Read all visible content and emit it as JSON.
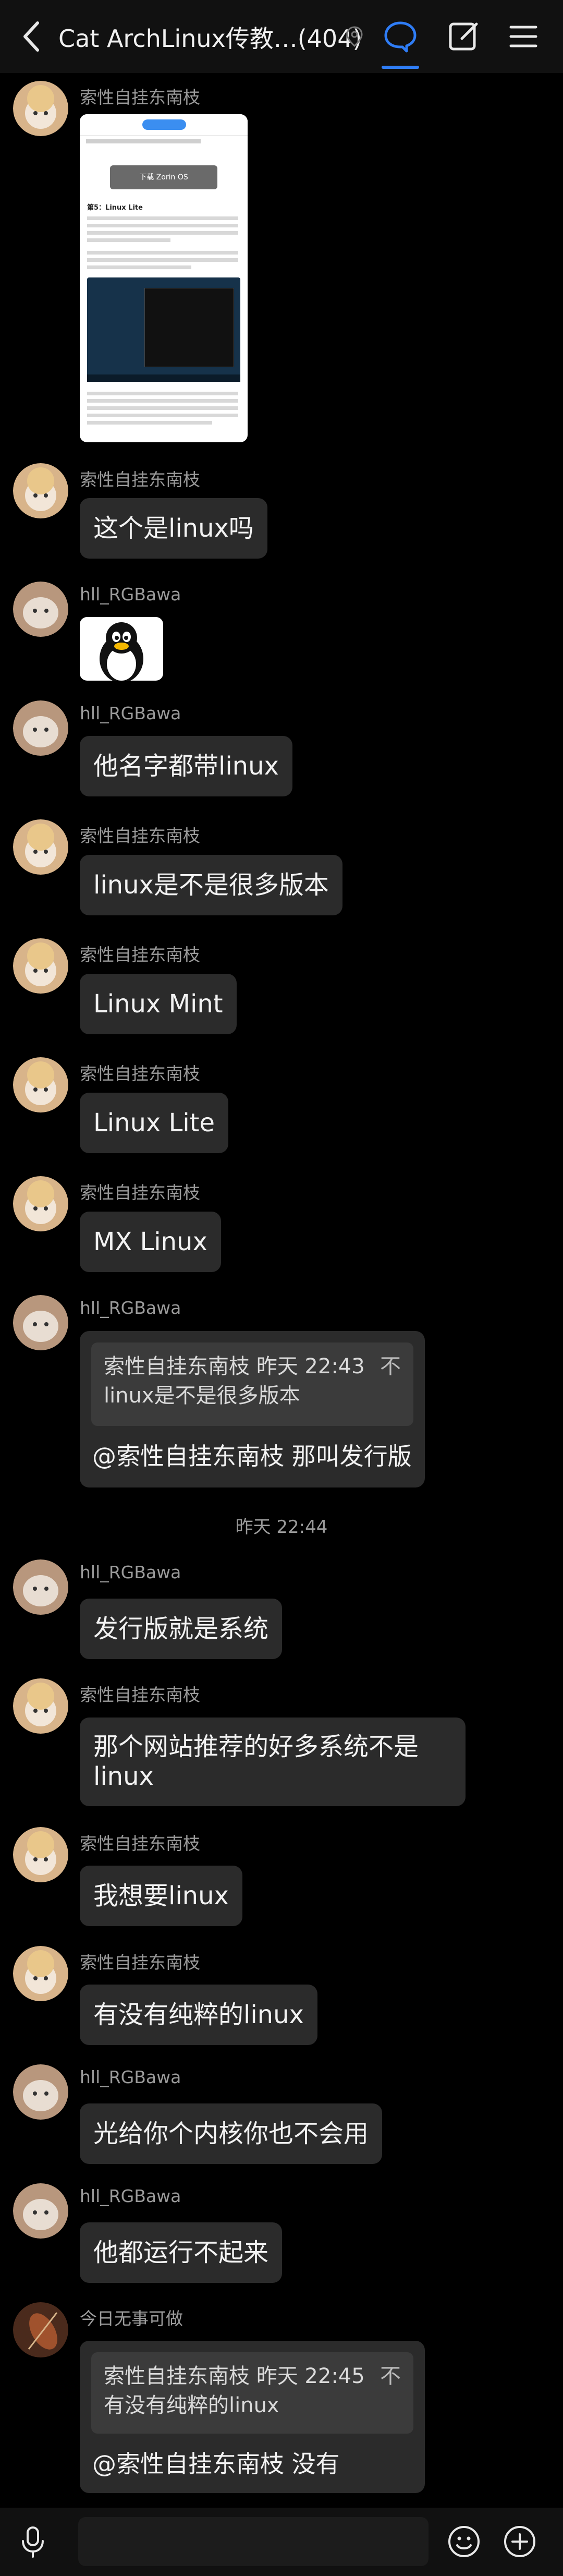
{
  "header": {
    "title": "Cat ArchLinux传教…(404)"
  },
  "icons": {
    "back": "chevron-left-icon",
    "location": "location-pin-icon",
    "chat": "chat-bubble-icon",
    "edit": "edit-note-icon",
    "menu": "hamburger-menu-icon",
    "voice": "microphone-icon",
    "emoji": "emoji-icon",
    "add": "plus-circle-icon"
  },
  "messages": [
    {
      "sender": "索性自挂东南枝",
      "type": "image"
    },
    {
      "sender": "索性自挂东南枝",
      "text": "这个是linux吗"
    },
    {
      "sender": "hll_RGBawa",
      "type": "sticker-penguin"
    },
    {
      "sender": "hll_RGBawa",
      "text": "他名字都带linux"
    },
    {
      "sender": "索性自挂东南枝",
      "text": "linux是不是很多版本"
    },
    {
      "sender": "索性自挂东南枝",
      "text": "Linux Mint"
    },
    {
      "sender": "索性自挂东南枝",
      "text": "Linux Lite"
    },
    {
      "sender": "索性自挂东南枝",
      "text": "MX Linux"
    },
    {
      "sender": "hll_RGBawa",
      "quote_header": "索性自挂东南枝 昨天 22:43",
      "quote_text": "linux是不是很多版本",
      "quote_close": "不",
      "text": "@索性自挂东南枝 那叫发行版"
    },
    {
      "sender": "hll_RGBawa",
      "text": "发行版就是系统"
    },
    {
      "sender": "索性自挂东南枝",
      "text_line1": "那个网站推荐的好多系统不是",
      "text_line2": "linux"
    },
    {
      "sender": "索性自挂东南枝",
      "text": "我想要linux"
    },
    {
      "sender": "索性自挂东南枝",
      "text": "有没有纯粹的linux"
    },
    {
      "sender": "hll_RGBawa",
      "text": "光给你个内核你也不会用"
    },
    {
      "sender": "hll_RGBawa",
      "text": "他都运行不起来"
    },
    {
      "sender": "今日无事可做",
      "quote_header": "索性自挂东南枝 昨天 22:45",
      "quote_text": "有没有纯粹的linux",
      "quote_close": "不",
      "text": "@索性自挂东南枝 没有"
    }
  ],
  "timestamp": "昨天 22:44",
  "screenshot": {
    "banner_button": "下载 Zorin OS",
    "section_title": "第5：Linux Lite"
  }
}
